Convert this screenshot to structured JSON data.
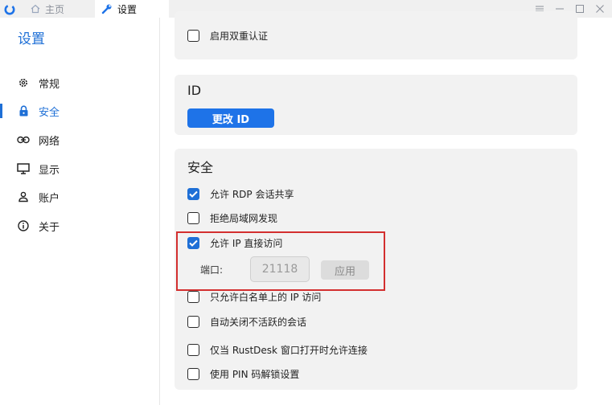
{
  "titlebar": {
    "tabs": [
      {
        "label": "主页",
        "icon": "home-icon"
      },
      {
        "label": "设置",
        "icon": "wrench-icon"
      }
    ],
    "controls": [
      "menu-icon",
      "minimize-icon",
      "maximize-icon",
      "close-icon"
    ]
  },
  "sidebar": {
    "title": "设置",
    "items": [
      {
        "label": "常规",
        "icon": "gear-icon"
      },
      {
        "label": "安全",
        "icon": "lock-icon",
        "active": true
      },
      {
        "label": "网络",
        "icon": "link-icon"
      },
      {
        "label": "显示",
        "icon": "monitor-icon"
      },
      {
        "label": "账户",
        "icon": "person-icon"
      },
      {
        "label": "关于",
        "icon": "info-icon"
      }
    ]
  },
  "main": {
    "card_top": {
      "options": [
        {
          "label": "启用双重认证",
          "checked": false
        }
      ]
    },
    "card_id": {
      "title": "ID",
      "button_label": "更改 ID"
    },
    "card_security": {
      "title": "安全",
      "options": [
        {
          "label": "允许 RDP 会话共享",
          "checked": true
        },
        {
          "label": "拒绝局域网发现",
          "checked": false
        },
        {
          "label": "允许 IP 直接访问",
          "checked": true
        },
        {
          "label": "只允许白名单上的 IP 访问",
          "checked": false
        },
        {
          "label": "自动关闭不活跃的会话",
          "checked": false
        },
        {
          "label": "仅当 RustDesk 窗口打开时允许连接",
          "checked": false
        },
        {
          "label": "使用 PIN 码解锁设置",
          "checked": false
        }
      ],
      "port_label": "端口:",
      "port_value": "21118",
      "apply_label": "应用"
    }
  },
  "colors": {
    "accent": "#1e6fd6",
    "button": "#1e73e8",
    "highlight": "#d32f2f",
    "card_bg": "#f2f2f2"
  }
}
